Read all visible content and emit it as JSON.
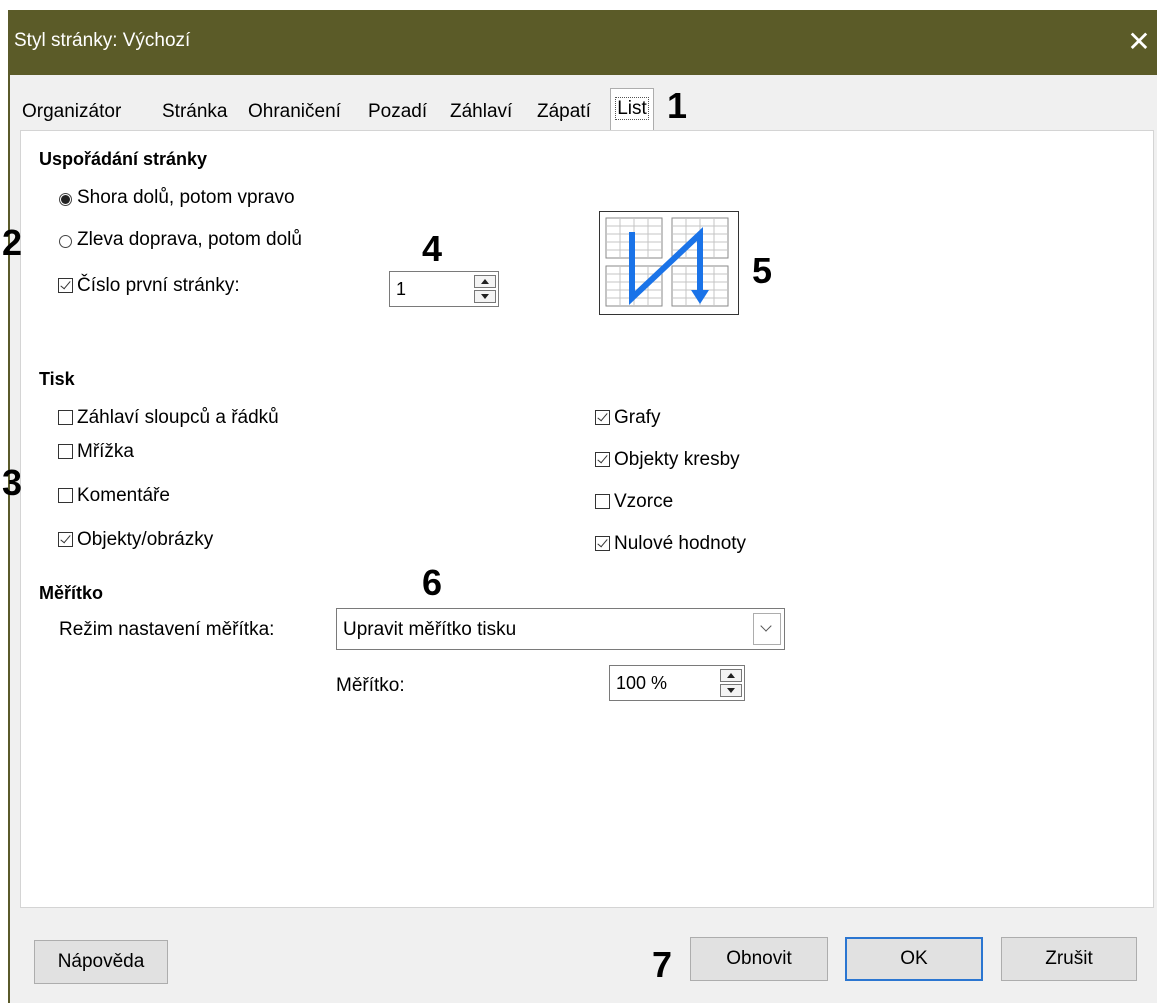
{
  "window": {
    "title": "Styl stránky: Výchozí",
    "close_glyph": "✕"
  },
  "tabs": [
    {
      "label": "Organizátor"
    },
    {
      "label": "Stránka"
    },
    {
      "label": "Ohraničení"
    },
    {
      "label": "Pozadí"
    },
    {
      "label": "Záhlaví"
    },
    {
      "label": "Zápatí"
    },
    {
      "label": "List",
      "active": true
    }
  ],
  "page_order": {
    "heading": "Uspořádání stránky",
    "option_top_down": "Shora dolů, potom vpravo",
    "option_left_right": "Zleva doprava, potom dolů",
    "selected": "top_down",
    "first_page_label": "Číslo první stránky:",
    "first_page_checked": true,
    "first_page_value": "1"
  },
  "print": {
    "heading": "Tisk",
    "left": [
      {
        "label": "Záhlaví sloupců a řádků",
        "checked": false
      },
      {
        "label": "Mřížka",
        "checked": false
      },
      {
        "label": "Komentáře",
        "checked": false
      },
      {
        "label": "Objekty/obrázky",
        "checked": true
      }
    ],
    "right": [
      {
        "label": "Grafy",
        "checked": true
      },
      {
        "label": "Objekty kresby",
        "checked": true
      },
      {
        "label": "Vzorce",
        "checked": false
      },
      {
        "label": "Nulové hodnoty",
        "checked": true
      }
    ]
  },
  "scale": {
    "heading": "Měřítko",
    "mode_label": "Režim nastavení měřítka:",
    "mode_value": "Upravit měřítko tisku",
    "scale_label": "Měřítko:",
    "scale_value": "100 %"
  },
  "buttons": {
    "help": "Nápověda",
    "reset": "Obnovit",
    "ok": "OK",
    "cancel": "Zrušit"
  },
  "callouts": [
    "1",
    "2",
    "3",
    "4",
    "5",
    "6",
    "7"
  ],
  "colors": {
    "titlebar": "#5b5b28",
    "accent": "#2b76d1",
    "preview_arrow": "#1a73e8"
  }
}
